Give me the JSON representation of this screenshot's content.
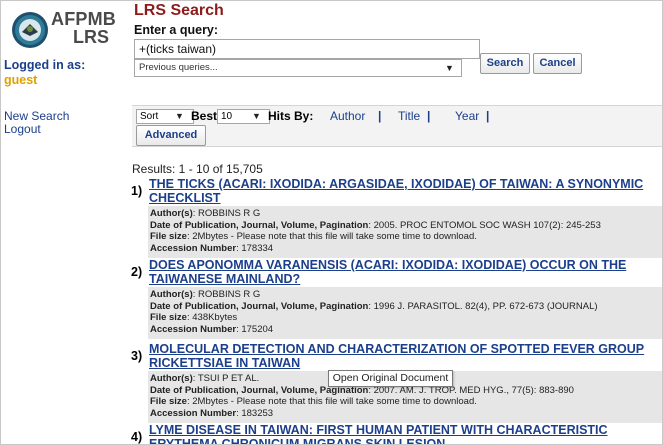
{
  "sidebar": {
    "logo_line1": "AFPMB",
    "logo_line2": "LRS",
    "logged_in_label": "Logged in as:",
    "user": "guest",
    "links": [
      "New Search",
      "Logout"
    ]
  },
  "header": {
    "title": "LRS Search",
    "query_label": "Enter a query:"
  },
  "search": {
    "query_value": "+(ticks taiwan)",
    "search_label": "Search",
    "cancel_label": "Cancel",
    "previous_queries": "Previous queries..."
  },
  "toolbar": {
    "sort": "Sort",
    "best_label": "Best",
    "best_value": "10",
    "hits_by_label": "Hits By:",
    "hits_links": [
      "Author",
      "Title",
      "Year"
    ],
    "advanced_label": "Advanced"
  },
  "results": {
    "count_text": "Results: 1 - 10 of 15,705",
    "labels": {
      "authors": "Author(s)",
      "publication": "Date of Publication, Journal, Volume, Pagination",
      "file_size": "File size",
      "accession": "Accession Number"
    },
    "items": [
      {
        "num": "1)",
        "title": "THE TICKS (ACARI: IXODIDA: ARGASIDAE, IXODIDAE) OF TAIWAN: A SYNONYMIC CHECKLIST",
        "authors": "ROBBINS R G",
        "publication": "2005. PROC ENTOMOL SOC WASH 107(2): 245-253",
        "file_size": "2Mbytes - Please note that this file will take some time to download.",
        "accession": "178334"
      },
      {
        "num": "2)",
        "title": "DOES APONOMMA VARANENSIS (ACARI: IXODIDA: IXODIDAE) OCCUR ON THE TAIWANESE MAINLAND?",
        "authors": "ROBBINS R G",
        "publication": "1996 J. PARASITOL. 82(4), PP. 672-673 (JOURNAL)",
        "file_size": "438Kbytes",
        "accession": "175204"
      },
      {
        "num": "3)",
        "title": "MOLECULAR DETECTION AND CHARACTERIZATION OF SPOTTED FEVER GROUP RICKETTSIAE IN TAIWAN",
        "authors": "TSUI P ET AL.",
        "publication": "2007. AM. J. TROP. MED HYG., 77(5): 883-890",
        "file_size": "2Mbytes - Please note that this file will take some time to download.",
        "accession": "183253"
      },
      {
        "num": "4)",
        "title": "LYME DISEASE IN TAIWAN: FIRST HUMAN PATIENT WITH CHARACTERISTIC ERYTHEMA CHRONICUM MIGRANS SKIN LESION"
      }
    ]
  },
  "tooltip": "Open Original Document",
  "colors": {
    "title": "#8c1c1c",
    "link": "#1c3f8c",
    "user": "#e0a000",
    "detail_bg": "#e6e6e6"
  }
}
